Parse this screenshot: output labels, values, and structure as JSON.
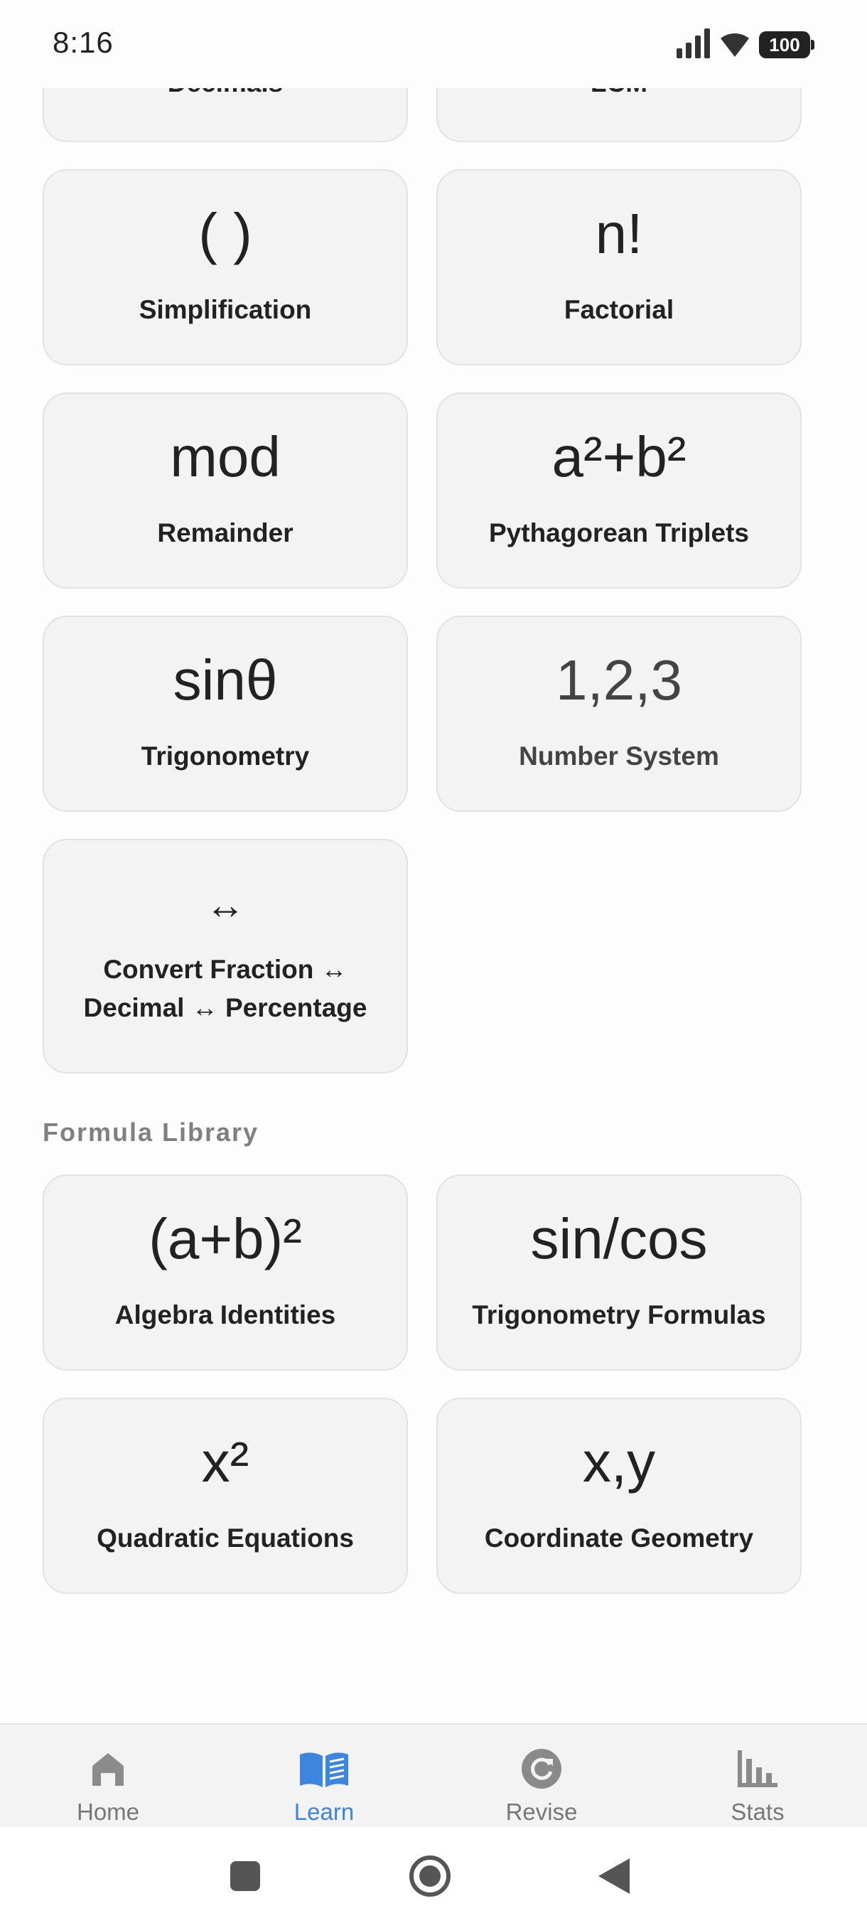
{
  "status": {
    "time": "8:16",
    "battery": "100"
  },
  "cards_top": [
    {
      "label": "Decimals"
    },
    {
      "label": "LCM"
    }
  ],
  "cards": [
    {
      "symbol": "( )",
      "label": "Simplification"
    },
    {
      "symbol": "n!",
      "label": "Factorial"
    },
    {
      "symbol": "mod",
      "label": "Remainder"
    },
    {
      "symbol": "a²+b²",
      "label": "Pythagorean Triplets"
    },
    {
      "symbol": "sinθ",
      "label": "Trigonometry"
    },
    {
      "symbol": "1,2,3",
      "label": "Number System"
    },
    {
      "symbol": "↔",
      "label_line1": "Convert Fraction ↔",
      "label_line2": "Decimal ↔ Percentage"
    }
  ],
  "formula_library": {
    "title": "Formula Library",
    "cards": [
      {
        "symbol": "(a+b)²",
        "label": "Algebra Identities"
      },
      {
        "symbol": "sin/cos",
        "label": "Trigonometry Formulas"
      },
      {
        "symbol": "x²",
        "label": "Quadratic Equations"
      },
      {
        "symbol": "x,y",
        "label": "Coordinate Geometry"
      }
    ]
  },
  "bottom_nav": [
    {
      "label": "Home",
      "icon": "home-icon"
    },
    {
      "label": "Learn",
      "icon": "book-icon",
      "active": true
    },
    {
      "label": "Revise",
      "icon": "refresh-icon"
    },
    {
      "label": "Stats",
      "icon": "bar-chart-icon"
    }
  ],
  "colors": {
    "accent": "#3d86e0",
    "card_bg": "#f3f3f3",
    "muted": "#808080"
  }
}
